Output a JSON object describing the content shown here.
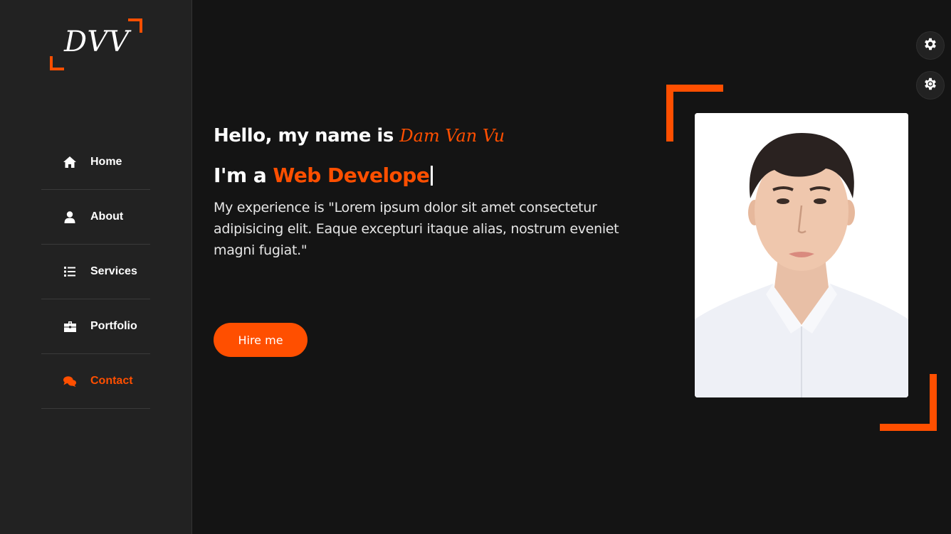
{
  "logo": {
    "text": "DVV"
  },
  "nav": [
    {
      "label": "Home",
      "icon": "home-icon",
      "active": false
    },
    {
      "label": "About",
      "icon": "user-icon",
      "active": false
    },
    {
      "label": "Services",
      "icon": "list-icon",
      "active": false
    },
    {
      "label": "Portfolio",
      "icon": "briefcase-icon",
      "active": false
    },
    {
      "label": "Contact",
      "icon": "comments-icon",
      "active": true
    }
  ],
  "hero": {
    "greeting": "Hello, my name is",
    "name": "Dam Van Vu",
    "role_prefix": "I'm a",
    "role_typed": "Web Develope",
    "description": "My experience is \"Lorem ipsum dolor sit amet consectetur adipisicing elit. Eaque excepturi itaque alias, nostrum eveniet magni fugiat.\"",
    "button_label": "Hire me"
  },
  "tools": [
    {
      "icon": "gear-icon"
    },
    {
      "icon": "sun-gear-icon"
    }
  ],
  "colors": {
    "accent": "#ff4f00",
    "sidebar_bg": "#222222",
    "main_bg": "#141414"
  }
}
